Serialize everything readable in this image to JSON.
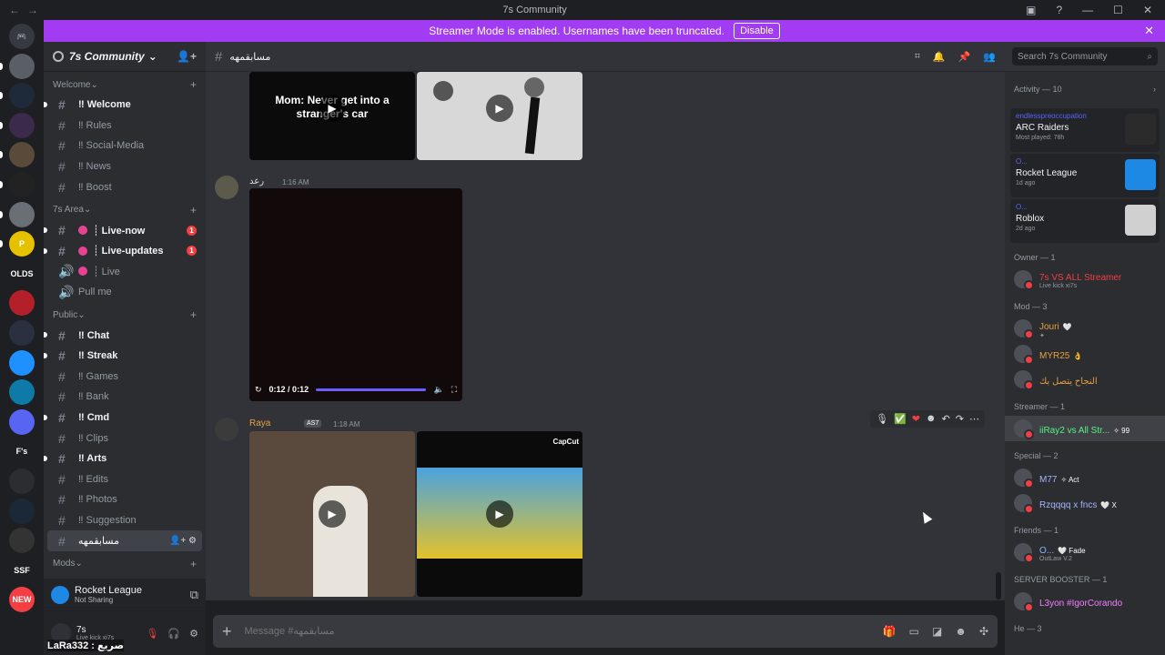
{
  "window": {
    "title": "7s Community",
    "back": "←",
    "forward": "→"
  },
  "banner": {
    "text": "Streamer Mode is enabled. Usernames have been truncated.",
    "disable": "Disable",
    "close": "✕"
  },
  "servers": [
    {
      "label": "🎮",
      "badge": "54",
      "color": "#36393f"
    },
    {
      "label": "",
      "badge": "1",
      "color": "#5a5f66"
    },
    {
      "label": "",
      "badge": "",
      "color": "#1e2a3a"
    },
    {
      "label": "",
      "badge": "2",
      "color": "#3b2a4a"
    },
    {
      "label": "",
      "badge": "1",
      "color": "#5a4a3a"
    },
    {
      "label": "",
      "badge": "",
      "color": "#222"
    },
    {
      "label": "",
      "badge": "1",
      "color": "#6a6f76"
    },
    {
      "label": "P",
      "badge": "6",
      "color": "#e5c100"
    },
    {
      "label": "OLDS",
      "badge": "",
      "color": "#1e1f22"
    },
    {
      "label": "",
      "badge": "",
      "color": "#b3202a"
    },
    {
      "label": "",
      "badge": "56",
      "color": "#2a3040"
    },
    {
      "label": "",
      "badge": "",
      "color": "#1e90ff"
    },
    {
      "label": "",
      "badge": "1K+",
      "color": "#0e7aa8"
    },
    {
      "label": "",
      "badge": "",
      "color": "#5865f2"
    },
    {
      "label": "F's",
      "badge": "",
      "color": "#1e1f22"
    },
    {
      "label": "",
      "badge": "",
      "color": "#2b2d31"
    },
    {
      "label": "",
      "badge": "",
      "color": "#1b2838"
    },
    {
      "label": "",
      "badge": "10",
      "color": "#333"
    },
    {
      "label": "SSF",
      "badge": "",
      "color": "#1e1f22"
    },
    {
      "label": "NEW",
      "badge": "",
      "color": "#f23f43"
    }
  ],
  "guild": {
    "name": "7s Community"
  },
  "categories": [
    {
      "name": "Welcome",
      "channels": [
        {
          "name": "‼ Welcome",
          "unread": true,
          "type": "text"
        },
        {
          "name": "‼ Rules",
          "unread": false,
          "type": "text"
        },
        {
          "name": "‼ Social-Media",
          "unread": false,
          "type": "text"
        },
        {
          "name": "‼ News",
          "unread": false,
          "type": "text"
        },
        {
          "name": "‼ Boost",
          "unread": false,
          "type": "text"
        }
      ]
    },
    {
      "name": "7s Area",
      "channels": [
        {
          "name": "┊ Live-now",
          "unread": true,
          "type": "text",
          "dot": true,
          "mention": "1"
        },
        {
          "name": "┊ Live-updates",
          "unread": true,
          "type": "text",
          "dot": true,
          "mention": "1"
        },
        {
          "name": "┊ Live",
          "unread": false,
          "type": "voice",
          "dot": true
        },
        {
          "name": "Pull me",
          "unread": false,
          "type": "voice"
        }
      ]
    },
    {
      "name": "Public",
      "channels": [
        {
          "name": "‼ Chat",
          "unread": true,
          "type": "text"
        },
        {
          "name": "‼ Streak",
          "unread": true,
          "type": "text"
        },
        {
          "name": "‼ Games",
          "unread": false,
          "type": "text"
        },
        {
          "name": "‼ Bank",
          "unread": false,
          "type": "text"
        },
        {
          "name": "‼ Cmd",
          "unread": true,
          "type": "text"
        },
        {
          "name": "‼ Clips",
          "unread": false,
          "type": "text"
        },
        {
          "name": "‼ Arts",
          "unread": true,
          "type": "text"
        },
        {
          "name": "‼ Edits",
          "unread": false,
          "type": "text"
        },
        {
          "name": "‼ Photos",
          "unread": false,
          "type": "text"
        },
        {
          "name": "‼ Suggestion",
          "unread": false,
          "type": "text"
        },
        {
          "name": "مسابقمهه",
          "unread": false,
          "type": "text",
          "active": true
        }
      ]
    },
    {
      "name": "Mods",
      "channels": []
    }
  ],
  "voice": {
    "title": "Rocket League",
    "sub": "Not Sharing"
  },
  "me": {
    "name": "7s",
    "status": "Live kick xi7s"
  },
  "overlay": "LaRa332 : صريع",
  "header": {
    "channel": "مسابقمهه"
  },
  "search": {
    "placeholder": "Search 7s Community"
  },
  "messages": [
    {
      "author": "",
      "time": "",
      "caption": "Mom: Never get into a stranger's car"
    },
    {
      "author": "رعد",
      "time": "1:16 AM",
      "video": {
        "time": "0:12 / 0:12",
        "progress": 1.0
      }
    },
    {
      "author": "Raya",
      "tag": "AS7",
      "time": "1:18 AM",
      "watermark": "CapCut"
    }
  ],
  "hover_actions": [
    "🎙",
    "✅",
    "❤",
    "☻",
    "↶",
    "↷",
    "⋯"
  ],
  "composer": {
    "placeholder": "Message #مسابقمهه"
  },
  "members": {
    "activity_header": "Activity — 10",
    "activities": [
      {
        "user": "endlesspreoccupation",
        "game": "ARC Raiders",
        "detail": "Most played: 78h",
        "thumb": "#2b2b2b"
      },
      {
        "user": "O...",
        "game": "Rocket League",
        "detail": "1d ago",
        "thumb": "#1e88e5"
      },
      {
        "user": "O...",
        "game": "Roblox",
        "detail": "2d ago",
        "thumb": "#d0d0d0"
      }
    ],
    "groups": [
      {
        "title": "Owner — 1",
        "members": [
          {
            "name": "7s VS ALL Streamer",
            "sub": "Live kick xi7s",
            "color": "#f23f43"
          }
        ]
      },
      {
        "title": "Mod — 3",
        "members": [
          {
            "name": "Jouri",
            "sub": "✦",
            "color": "#e6a040",
            "tag": "🤍"
          },
          {
            "name": "MYR25",
            "sub": "",
            "color": "#e6a040",
            "tag": "👌"
          },
          {
            "name": "النجاح يتصل بك",
            "sub": "",
            "color": "#e6a040"
          }
        ]
      },
      {
        "title": "Streamer — 1",
        "members": [
          {
            "name": "iiRay2 vs All Str...",
            "sub": "",
            "color": "#57f287",
            "tag": "✧ 99",
            "highlight": true
          }
        ]
      },
      {
        "title": "Special — 2",
        "members": [
          {
            "name": "M77",
            "sub": "",
            "color": "#a5b4fc",
            "tag": "✧ Act"
          },
          {
            "name": "Rzqqqq x fncs",
            "sub": "",
            "color": "#a5b4fc",
            "tag": "🤍 X"
          }
        ]
      },
      {
        "title": "Friends — 1",
        "members": [
          {
            "name": "O...",
            "sub": "OutLaw V.2",
            "color": "#8ab4f8",
            "tag": "🤍 Fade"
          }
        ]
      },
      {
        "title": "SERVER BOOSTER — 1",
        "members": [
          {
            "name": "L3yon #IgorCorando",
            "sub": "",
            "color": "#f47fff"
          }
        ]
      },
      {
        "title": "He — 3",
        "members": []
      }
    ]
  }
}
